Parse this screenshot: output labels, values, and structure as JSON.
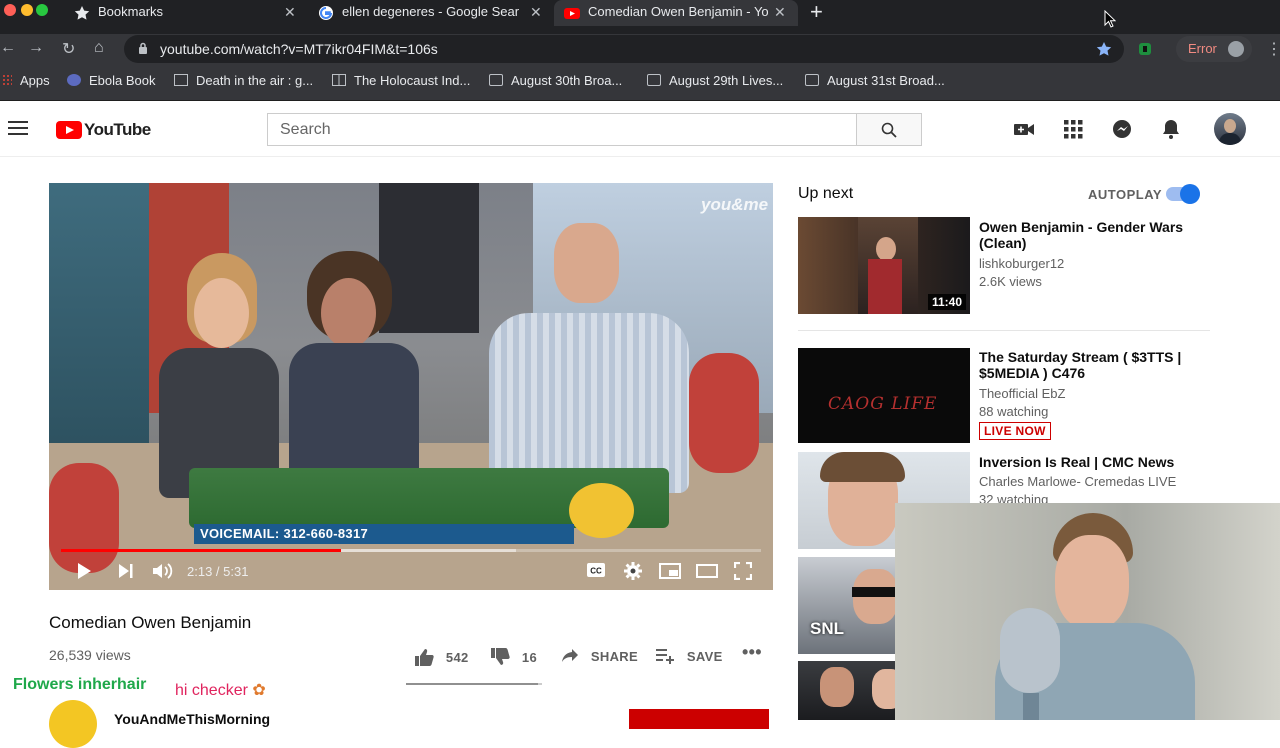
{
  "browser": {
    "tabs": [
      {
        "title": "Bookmarks",
        "icon": "star-icon"
      },
      {
        "title": "ellen degeneres - Google Sear",
        "icon": "google-icon"
      },
      {
        "title": "Comedian Owen Benjamin - Yo",
        "icon": "youtube-icon",
        "active": true
      }
    ],
    "url": "youtube.com/watch?v=MT7ikr04FIM&t=106s",
    "error_label": "Error",
    "bookmarks": [
      "Apps",
      "Ebola Book",
      "Death in the air : g...",
      "The Holocaust Ind...",
      "August 30th Broa...",
      "August 29th Lives...",
      "August 31st Broad..."
    ]
  },
  "youtube": {
    "logo_text": "YouTube",
    "search_placeholder": "Search",
    "video": {
      "overlay_caption": "VOICEMAIL: 312-660-8317",
      "watermark": "you&me",
      "time_current": "2:13",
      "time_total": "5:31",
      "time_display": "2:13 / 5:31",
      "progress_fraction": 0.4,
      "buffered_fraction": 0.65,
      "title": "Comedian Owen Benjamin",
      "views": "26,539 views",
      "likes": "542",
      "dislikes": "16",
      "like_fraction": 0.97,
      "share_label": "SHARE",
      "save_label": "SAVE",
      "channel": "YouAndMeThisMorning"
    },
    "chat": {
      "line1": "Flowers inherhair",
      "line2": "hi checker"
    },
    "sidebar": {
      "up_next_label": "Up next",
      "autoplay_label": "AUTOPLAY",
      "autoplay_on": true,
      "items": [
        {
          "title": "Owen Benjamin - Gender Wars (Clean)",
          "channel": "lishkoburger12",
          "meta": "2.6K views",
          "duration": "11:40"
        },
        {
          "title": "The Saturday Stream ( $3TTS | $5MEDIA ) C476",
          "channel": "Theofficial EbZ",
          "meta": "88 watching",
          "badge": "LIVE NOW",
          "thumb_text": "CAOG LIFE"
        },
        {
          "title": "Inversion Is Real | CMC News",
          "channel": "Charles Marlowe- Cremedas LIVE",
          "meta": "32 watching"
        },
        {
          "thumb_text": "SNL"
        }
      ]
    }
  },
  "colors": {
    "youtube_red": "#ff0000",
    "chrome_dark": "#202124",
    "link_blue": "#1a73e8"
  }
}
